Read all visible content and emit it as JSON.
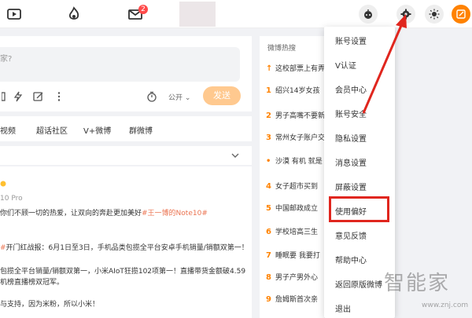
{
  "topbar": {
    "message_badge": "2",
    "icons": [
      "video-icon",
      "flame-icon",
      "mail-icon",
      "bot-icon",
      "gear-icon",
      "sun-icon",
      "edit-icon"
    ]
  },
  "composer": {
    "placeholder": "家?",
    "visibility": "公开",
    "send_label": "发送"
  },
  "tabs": [
    "视频",
    "超话社区",
    "V+微博",
    "群微博"
  ],
  "feed": {
    "source": "10 Pro",
    "line1_pre": "你们不顾一切的热爱，让双向的奔赴更加美好",
    "line1_tag": "#王一博的Note10#",
    "line2_tag": "#",
    "line2": "开门红战报：6月1日至3日，手机品类包揽全平台安卓手机销量/销额双第一！",
    "line3": "包揽全平台销量/销额双第一，小米AIoT狂揽102项第一！直播带货金额破4.59",
    "line4": "机榜直播榜双冠军。",
    "line5": "与支持，因为米粉，所以小米！"
  },
  "hot": {
    "title": "微博热搜",
    "items": [
      {
        "rank": "",
        "text": "这校部票上有弄"
      },
      {
        "rank": "1",
        "text": "绍兴14岁女孩"
      },
      {
        "rank": "2",
        "text": ""
      },
      {
        "rank": "2",
        "text": "男子高嘴不要新"
      },
      {
        "rank": "3",
        "text": "常州女子账户交"
      },
      {
        "rank": "",
        "text": ""
      },
      {
        "rank": "•",
        "text": "沙漠 有机 就是"
      },
      {
        "rank": "4",
        "text": "女子超市买到"
      },
      {
        "rank": "5",
        "text": "中国邮政成立"
      },
      {
        "rank": "6",
        "text": "学校培高三生"
      },
      {
        "rank": "7",
        "text": "睡眠要 我要打"
      },
      {
        "rank": "8",
        "text": "男子产男外心"
      },
      {
        "rank": "9",
        "text": "詹姆斯首次亲"
      }
    ]
  },
  "menu": {
    "items": [
      "账号设置",
      "V认证",
      "会员中心",
      "账号安全",
      "隐私设置",
      "消息设置",
      "屏蔽设置",
      "使用偏好",
      "意见反馈",
      "帮助中心",
      "返回原版微博",
      "退出"
    ]
  },
  "watermark": {
    "main": "智能家",
    "url": "www.znj.com"
  },
  "colors": {
    "accent": "#ff8200",
    "highlight": "#e0261e",
    "send": "#ffc98f"
  }
}
